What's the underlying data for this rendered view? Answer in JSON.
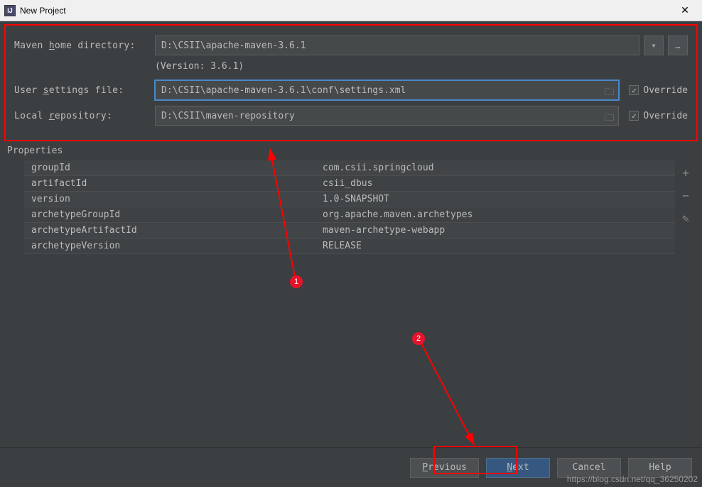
{
  "window": {
    "title": "New Project"
  },
  "maven": {
    "home_label_pre": "Maven ",
    "home_label_mn": "h",
    "home_label_post": "ome directory:",
    "home_path": "D:\\CSII\\apache-maven-3.6.1",
    "version_text": "(Version: 3.6.1)",
    "settings_label_pre": "User ",
    "settings_label_mn": "s",
    "settings_label_post": "ettings file:",
    "settings_path": "D:\\CSII\\apache-maven-3.6.1\\conf\\settings.xml",
    "repo_label_pre": "Local ",
    "repo_label_mn": "r",
    "repo_label_post": "epository:",
    "repo_path": "D:\\CSII\\maven-repository",
    "override_label": "Override"
  },
  "properties": {
    "section_label": "Properties",
    "rows": [
      {
        "key": "groupId",
        "val": "com.csii.springcloud"
      },
      {
        "key": "artifactId",
        "val": "csii_dbus"
      },
      {
        "key": "version",
        "val": "1.0-SNAPSHOT"
      },
      {
        "key": "archetypeGroupId",
        "val": "org.apache.maven.archetypes"
      },
      {
        "key": "archetypeArtifactId",
        "val": "maven-archetype-webapp"
      },
      {
        "key": "archetypeVersion",
        "val": "RELEASE"
      }
    ]
  },
  "buttons": {
    "previous_mn": "P",
    "previous_rest": "revious",
    "next_mn": "N",
    "next_rest": "ext",
    "cancel": "Cancel",
    "help": "Help"
  },
  "annotations": {
    "badge1": "1",
    "badge2": "2"
  },
  "watermark": "https://blog.csdn.net/qq_36250202"
}
